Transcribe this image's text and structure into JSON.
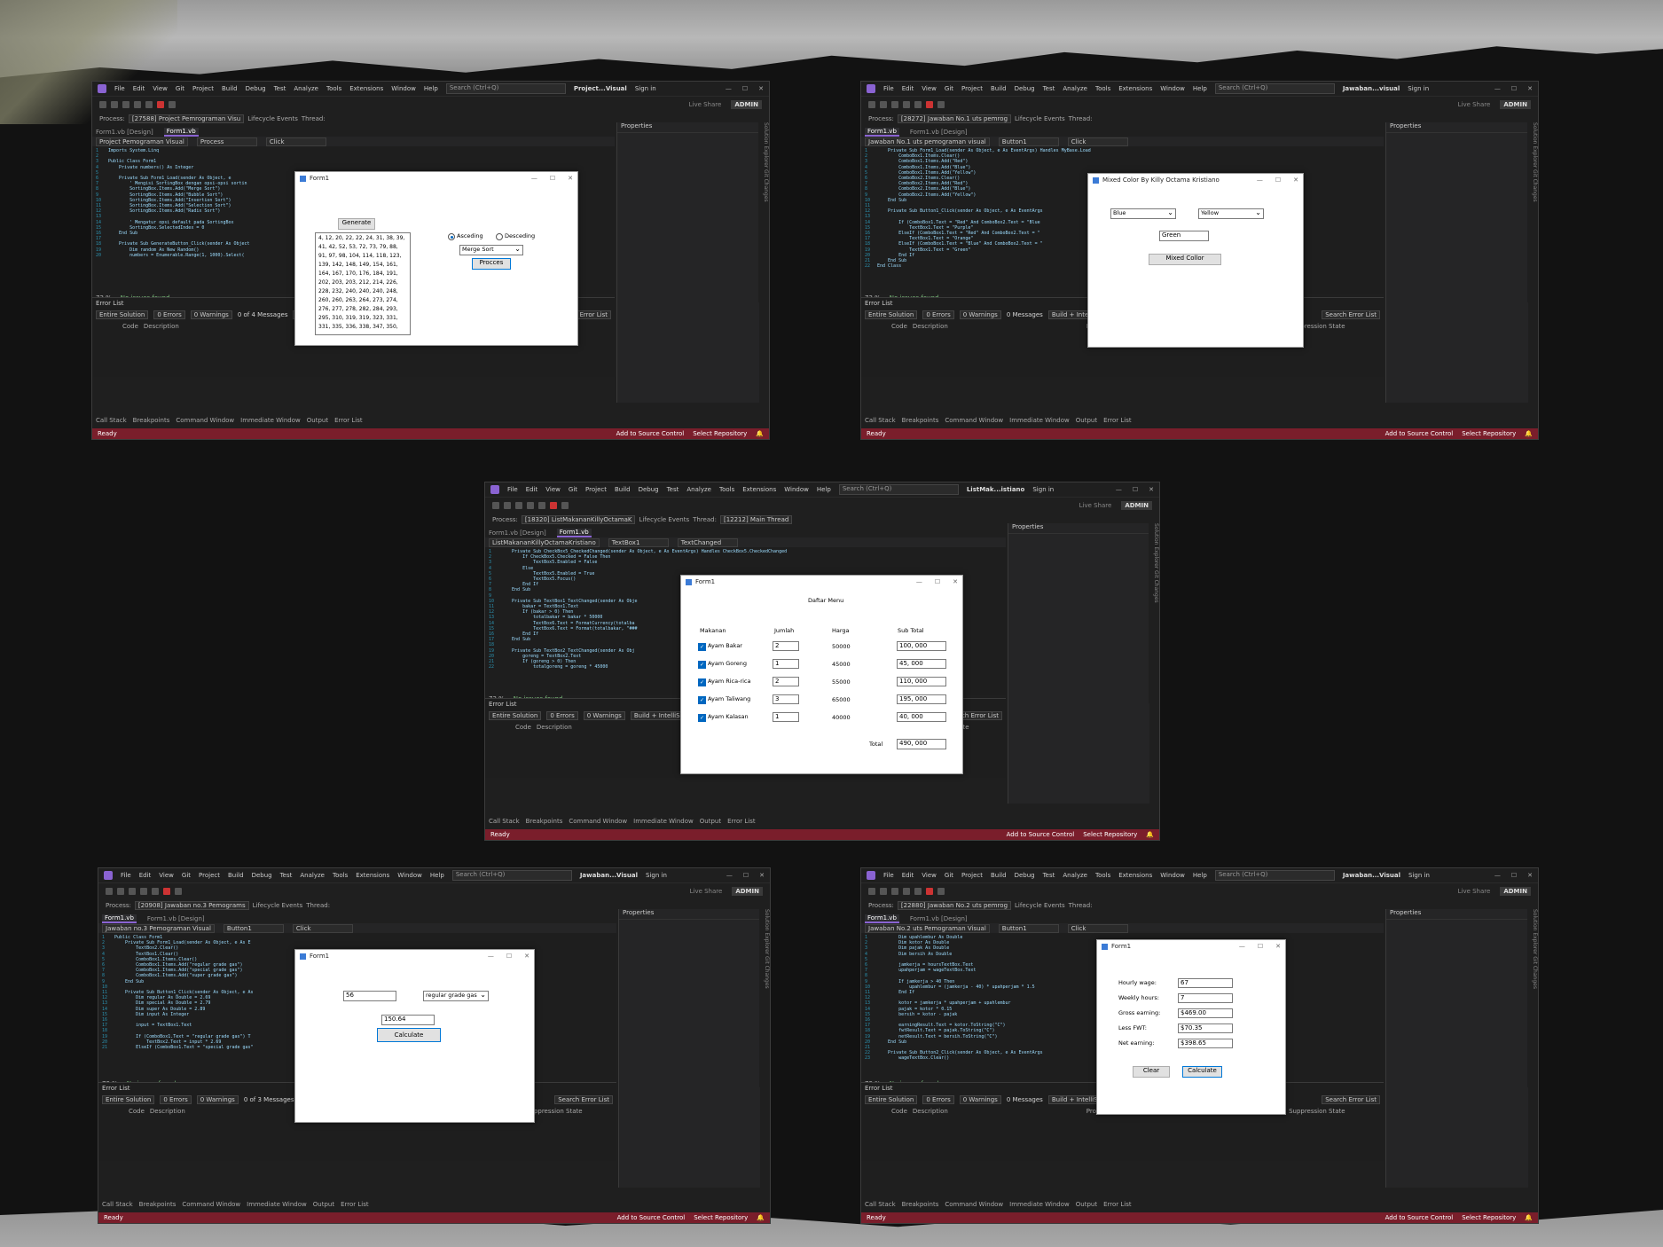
{
  "menu": [
    "File",
    "Edit",
    "View",
    "Git",
    "Project",
    "Build",
    "Debug",
    "Test",
    "Analyze",
    "Tools",
    "Extensions",
    "Window",
    "Help"
  ],
  "vs_common": {
    "search_placeholder": "Search (Ctrl+Q)",
    "sign_in": "Sign in",
    "live_share": "Live Share",
    "admin": "ADMIN",
    "process_label": "Process:",
    "lifecycle": "Lifecycle Events",
    "thread": "Thread:",
    "properties": "Properties",
    "error_list": "Error List",
    "entire_solution": "Entire Solution",
    "errors": "0 Errors",
    "warnings": "0 Warnings",
    "build": "Build + IntelliSense",
    "search_errors": "Search Error List",
    "col_code": "Code",
    "col_desc": "Description",
    "col_project": "Project",
    "col_file": "File",
    "col_line": "Line",
    "col_supp": "Suppression State",
    "bottom_tabs": [
      "Call Stack",
      "Breakpoints",
      "Command Window",
      "Immediate Window",
      "Output",
      "Error List"
    ],
    "status_ready": "Ready",
    "add_source": "Add to Source Control",
    "select_repo": "Select Repository",
    "no_issues": "No issues found",
    "zoom": "73 %",
    "solution_explorer": "Solution Explorer",
    "git_changes": "Git Changes"
  },
  "win1": {
    "title": "Project...Visual",
    "process": "[27588] Project Pemrograman Visu",
    "tabs": [
      "Form1.vb [Design]",
      "Form1.vb"
    ],
    "nav": [
      "Project Pemograman Visual",
      "Process",
      "Click"
    ],
    "messages": "0 of 4 Messages",
    "code": [
      "Imports System.Linq",
      "",
      "Public Class Form1",
      "    Private numbers() As Integer",
      "",
      "    Private Sub Form1_Load(sender As Object, e",
      "        ' Mengisi SortingBox dengan opsi-opsi sortin",
      "        SortingBox.Items.Add(\"Merge Sort\")",
      "        SortingBox.Items.Add(\"Bubble Sort\")",
      "        SortingBox.Items.Add(\"Insertion Sort\")",
      "        SortingBox.Items.Add(\"Selection Sort\")",
      "        SortingBox.Items.Add(\"Radix Sort\")",
      "",
      "        ' Mengatur opsi default pada SortingBox",
      "        SortingBox.SelectedIndex = 0",
      "    End Sub",
      "",
      "    Private Sub GenerateButton_Click(sender As Object",
      "        Dim random As New Random()",
      "        numbers = Enumerable.Range(1, 1000).Select("
    ],
    "form": {
      "title": "Form1",
      "generate": "Generate",
      "ascending": "Asceding",
      "descending": "Desceding",
      "sort_choice": "Merge Sort",
      "process_btn": "Procces",
      "list": [
        "4, 12, 20, 22, 22, 24, 31, 38, 39,",
        "41, 42, 52, 53, 72, 73, 79, 88,",
        "91, 97, 98, 104, 114, 118, 123,",
        "139, 142, 148, 149, 154, 161,",
        "164, 167, 170, 176, 184, 191,",
        "202, 203, 203, 212, 214, 226,",
        "228, 232, 240, 240, 240, 248,",
        "260, 260, 263, 264, 273, 274,",
        "276, 277, 278, 282, 284, 293,",
        "295, 310, 319, 319, 323, 331,",
        "331, 335, 336, 338, 347, 350,"
      ]
    }
  },
  "win2": {
    "title": "Jawaban...visual",
    "process": "[28272] Jawaban No.1 uts pemrog",
    "tabs": [
      "Form1.vb",
      "Form1.vb [Design]"
    ],
    "nav": [
      "Jawaban No.1 uts pemograman visual",
      "Button1",
      "Click"
    ],
    "messages": "0 Messages",
    "code": [
      "    Private Sub Form1_Load(sender As Object, e As EventArgs) Handles MyBase.Load",
      "        ComboBox1.Items.Clear()",
      "        ComboBox1.Items.Add(\"Red\")",
      "        ComboBox1.Items.Add(\"Blue\")",
      "        ComboBox1.Items.Add(\"Yellow\")",
      "        ComboBox2.Items.Clear()",
      "        ComboBox2.Items.Add(\"Red\")",
      "        ComboBox2.Items.Add(\"Blue\")",
      "        ComboBox2.Items.Add(\"Yellow\")",
      "    End Sub",
      "",
      "    Private Sub Button1_Click(sender As Object, e As EventArgs",
      "",
      "        If (ComboBox1.Text = \"Red\" And ComboBox2.Text = \"Blue",
      "            TextBox1.Text = \"Purple\"",
      "        ElseIf (ComboBox1.Text = \"Red\" And ComboBox2.Text = \"",
      "            TextBox1.Text = \"Orange\"",
      "        ElseIf (ComboBox1.Text = \"Blue\" And ComboBox2.Text = \"",
      "            TextBox1.Text = \"Green\"",
      "        End If",
      "    End Sub",
      "End Class"
    ],
    "status_pos": "Ch: 25",
    "form": {
      "title": "Mixed Color By Killy Octama Kristiano",
      "combo1": "Blue",
      "combo2": "Yellow",
      "result": "Green",
      "button": "Mixed Collor"
    }
  },
  "win3": {
    "title": "ListMak...istiano",
    "process": "[18320] ListMakananKillyOctamaK",
    "thread_val": "[12212] Main Thread",
    "tabs": [
      "Form1.vb [Design]",
      "Form1.vb"
    ],
    "nav": [
      "ListMakananKillyOctamaKristiano",
      "TextBox1",
      "TextChanged"
    ],
    "code": [
      "    Private Sub CheckBox5_CheckedChanged(sender As Object, e As EventArgs) Handles CheckBox5.CheckedChanged",
      "        If CheckBox5.Checked = False Then",
      "            TextBox5.Enabled = False",
      "        Else",
      "            TextBox5.Enabled = True",
      "            TextBox5.Focus()",
      "        End If",
      "    End Sub",
      "",
      "    Private Sub TextBox1_TextChanged(sender As Obje",
      "        bakar = TextBox1.Text",
      "        If (bakar > 0) Then",
      "            totalbakar = bakar * 50000",
      "            TextBox6.Text = FormatCurrency(totalba",
      "            TextBox6.Text = Format(totalbakar, \"###",
      "        End If",
      "    End Sub",
      "",
      "    Private Sub TextBox2_TextChanged(sender As Obj",
      "        goreng = TextBox2.Text",
      "        If (goreng > 0) Then",
      "            totalgoreng = goreng * 45000"
    ],
    "form": {
      "title": "Form1",
      "heading": "Daftar Menu",
      "col_makanan": "Makanan",
      "col_jumlah": "Jumlah",
      "col_harga": "Harga",
      "col_subtotal": "Sub Total",
      "rows": [
        {
          "name": "Ayam Bakar",
          "qty": "2",
          "price": "50000",
          "sub": "100, 000"
        },
        {
          "name": "Ayam Goreng",
          "qty": "1",
          "price": "45000",
          "sub": "45, 000"
        },
        {
          "name": "Ayam Rica-rica",
          "qty": "2",
          "price": "55000",
          "sub": "110, 000"
        },
        {
          "name": "Ayam Taliwang",
          "qty": "3",
          "price": "65000",
          "sub": "195, 000"
        },
        {
          "name": "Ayam Kalasan",
          "qty": "1",
          "price": "40000",
          "sub": "40, 000"
        }
      ],
      "total_label": "Total",
      "total_val": "490, 000"
    }
  },
  "win4": {
    "title": "Jawaban...Visual",
    "process": "[20908] Jawaban no.3 Pemograms",
    "tabs": [
      "Form1.vb",
      "Form1.vb [Design]"
    ],
    "nav": [
      "Jawaban no.3 Pemograman Visual",
      "Button1",
      "Click"
    ],
    "messages": "0 of 3 Messages",
    "status_pos": "Ch: 72",
    "code": [
      "Public Class Form1",
      "    Private Sub Form1_Load(sender As Object, e As E",
      "        TextBox2.Clear()",
      "        TextBox1.Clear()",
      "        ComboBox1.Items.Clear()",
      "        ComboBox1.Items.Add(\"regular grade gas\")",
      "        ComboBox1.Items.Add(\"special grade gas\")",
      "        ComboBox1.Items.Add(\"super grade gas\")",
      "    End Sub",
      "",
      "    Private Sub Button1_Click(sender As Object, e As",
      "        Dim regular As Double = 2.69",
      "        Dim special As Double = 2.79",
      "        Dim super As Double = 2.89",
      "        Dim input As Integer",
      "",
      "        input = TextBox1.Text",
      "",
      "        If (ComboBox1.Text = \"regular grade gas\") T",
      "            TextBox2.Text = input * 2.69",
      "        ElseIf (ComboBox1.Text = \"special grade gas\""
    ],
    "form": {
      "title": "Form1",
      "input": "56",
      "combo": "regular grade gas",
      "result": "150.64",
      "button": "Calculate"
    }
  },
  "win5": {
    "title": "Jawaban...Visual",
    "process": "[22880] Jawaban No.2 uts pemrog",
    "tabs": [
      "Form1.vb",
      "Form1.vb [Design]"
    ],
    "nav": [
      "Jawaban No.2 uts Pemograman Visual",
      "Button1",
      "Click"
    ],
    "messages": "0 Messages",
    "status_pos": "Ln: 18",
    "status_ch": "Ch: 29",
    "code": [
      "        Dim upahlembur As Double",
      "        Dim kotor As Double",
      "        Dim pajak As Double",
      "        Dim bersih As Double",
      "",
      "        jamkerja = hoursTextBox.Text",
      "        upahperjam = wageTextBox.Text",
      "",
      "        If jamkerja > 40 Then",
      "            upahlembur = (jamkerja - 40) * upahperjam * 1.5",
      "        End If",
      "",
      "        kotor = jamkerja * upahperjam + upahlembur",
      "        pajak = kotor * 0.15",
      "        bersih = kotor - pajak",
      "",
      "        earningResult.Text = kotor.ToString(\"C\")",
      "        fwtResult.Text = pajak.ToString(\"C\")",
      "        netResult.Text = bersih.ToString(\"C\")",
      "    End Sub",
      "",
      "    Private Sub Button2_Click(sender As Object, e As EventArgs",
      "        wageTextBox.Clear()"
    ],
    "form": {
      "title": "Form1",
      "labels": [
        "Hourly wage:",
        "Weekly hours:",
        "Gross earning:",
        "Less FWT:",
        "Net earning:"
      ],
      "values": [
        "67",
        "7",
        "$469.00",
        "$70.35",
        "$398.65"
      ],
      "clear": "Clear",
      "calculate": "Calculate"
    }
  }
}
